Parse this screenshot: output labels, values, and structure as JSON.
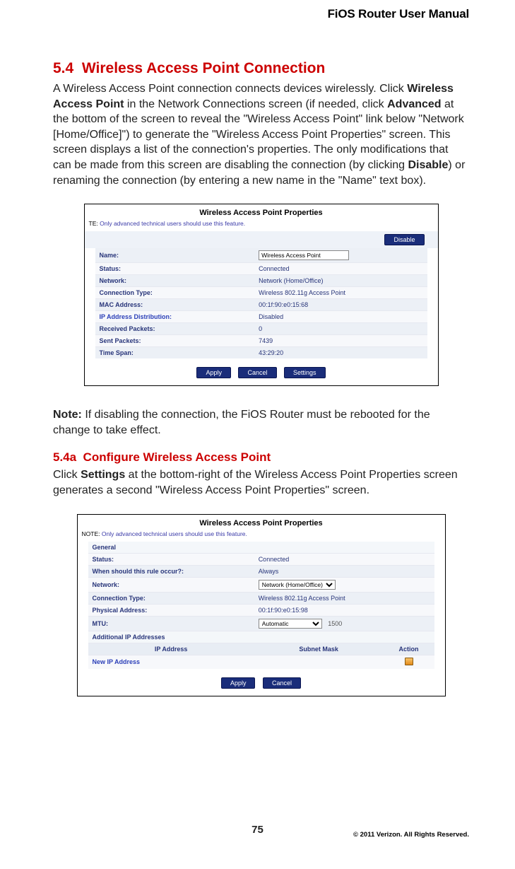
{
  "header": {
    "title": "FiOS Router User Manual"
  },
  "section": {
    "number": "5.4",
    "title": "Wireless Access Point Connection",
    "para_pre": "A Wireless Access Point connection connects devices wirelessly. Click ",
    "bold1": "Wireless Access Point",
    "para_mid1": " in the Network Connections screen (if needed, click ",
    "bold2": "Advanced",
    "para_mid2": " at the bottom of the screen to reveal the \"Wireless Access Point\" link below \"Network [Home/Office]\") to generate the \"Wireless Access Point Properties\" screen. This screen displays a list of the connection's properties. The only modifications that can be made from this screen are disabling the connection (by clicking ",
    "bold3": "Disable",
    "para_end": ") or renaming the connection (by entering a new name in the \"Name\" text box)."
  },
  "panel1": {
    "title": "Wireless Access Point Properties",
    "note_prefix": "TE:",
    "note_text": "Only advanced technical users should use this feature.",
    "disable_btn": "Disable",
    "rows": {
      "name_label": "Name:",
      "name_value": "Wireless Access Point",
      "status_label": "Status:",
      "status_value": "Connected",
      "network_label": "Network:",
      "network_value": "Network (Home/Office)",
      "conntype_label": "Connection Type:",
      "conntype_value": "Wireless 802.11g Access Point",
      "mac_label": "MAC Address:",
      "mac_value": "00:1f:90:e0:15:68",
      "ipdist_label": "IP Address Distribution:",
      "ipdist_value": "Disabled",
      "recv_label": "Received Packets:",
      "recv_value": "0",
      "sent_label": "Sent Packets:",
      "sent_value": "7439",
      "tspan_label": "Time Span:",
      "tspan_value": "43:29:20"
    },
    "buttons": {
      "apply": "Apply",
      "cancel": "Cancel",
      "settings": "Settings"
    }
  },
  "note_para": {
    "bold": "Note:",
    "text": " If disabling the connection, the FiOS Router must be rebooted for the change to take effect."
  },
  "subsection": {
    "number": "5.4a",
    "title": "Configure Wireless Access Point",
    "para_pre": "Click ",
    "bold1": "Settings",
    "para_end": " at the bottom-right of the Wireless Access Point Properties screen generates a second \"Wireless Access Point Properties\" screen."
  },
  "panel2": {
    "title": "Wireless Access Point Properties",
    "note_prefix": "NOTE:",
    "note_text": "Only advanced technical users should use this feature.",
    "general": "General",
    "rows": {
      "status_label": "Status:",
      "status_value": "Connected",
      "when_label": "When should this rule occur?:",
      "when_value": "Always",
      "network_label": "Network:",
      "network_value": "Network (Home/Office)",
      "conntype_label": "Connection Type:",
      "conntype_value": "Wireless 802.11g Access Point",
      "phys_label": "Physical Address:",
      "phys_value": "00:1f:90:e0:15:98",
      "mtu_label": "MTU:",
      "mtu_select": "Automatic",
      "mtu_num": "1500"
    },
    "addl_ip": "Additional IP Addresses",
    "ip_header": {
      "ip": "IP Address",
      "mask": "Subnet Mask",
      "action": "Action"
    },
    "new_ip": "New IP Address",
    "buttons": {
      "apply": "Apply",
      "cancel": "Cancel"
    }
  },
  "footer": {
    "page": "75",
    "copyright": "© 2011 Verizon. All Rights Reserved."
  }
}
